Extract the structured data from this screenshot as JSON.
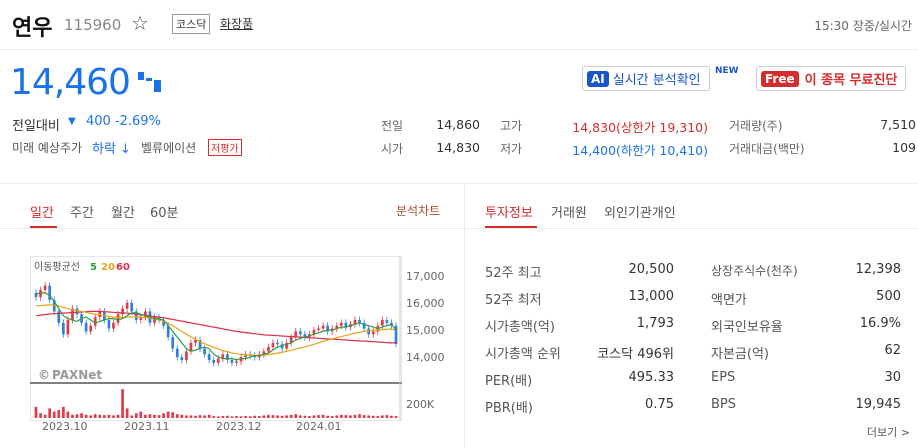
{
  "header": {
    "name": "연우",
    "code": "115960",
    "market": "코스닥",
    "sector": "화장품",
    "realtime": "15:30 장중/실시간"
  },
  "price": {
    "current": "14,460",
    "change_label": "전일대비",
    "change_value": "400 -2.69%",
    "future_label": "미래 예상주가",
    "future_value": "하락 ↓",
    "valuation_label": "벨류에이션",
    "valuation_badge": "저평가"
  },
  "promo": {
    "ai_tag": "AI",
    "ai_text": "실시간 분석확인",
    "new_tag": "NEW",
    "free_tag": "Free",
    "free_text": "이 종목 무료진단"
  },
  "stats": {
    "prev_label": "전일",
    "prev_value": "14,860",
    "open_label": "시가",
    "open_value": "14,830",
    "high_label": "고가",
    "high_value": "14,830(상한가 19,310)",
    "low_label": "저가",
    "low_value": "14,400(하한가 10,410)",
    "volume_label": "거래량(주)",
    "volume_value": "7,510",
    "amount_label": "거래대금(백만)",
    "amount_value": "109"
  },
  "chart_tabs": {
    "daily": "일간",
    "weekly": "주간",
    "monthly": "월간",
    "minute": "60분",
    "analysis": "분석차트"
  },
  "chart_data": {
    "type": "line",
    "legend_title": "이동평균선",
    "ma_labels": [
      "5",
      "20",
      "60"
    ],
    "y_ticks": [
      "17,000",
      "16,000",
      "15,000",
      "14,000"
    ],
    "ylim": [
      13200,
      17400
    ],
    "volume_tick": "200K",
    "x_ticks": [
      "2023.10",
      "2023.11",
      "2023.12",
      "2024.01"
    ],
    "watermark": "PAXNet",
    "colors": {
      "ma5": "#2e9e3e",
      "ma20": "#e8a317",
      "ma60": "#d9304e",
      "up": "#e23b4b",
      "down": "#2f7fe0"
    },
    "closes": [
      16100,
      16350,
      16500,
      16000,
      15600,
      15200,
      14800,
      15300,
      15700,
      15500,
      15200,
      14900,
      15100,
      15400,
      15600,
      15300,
      15000,
      15200,
      15500,
      15700,
      15900,
      15600,
      15300,
      15400,
      15600,
      15200,
      15400,
      15300,
      15100,
      14700,
      14300,
      14000,
      13900,
      14200,
      14500,
      14600,
      14300,
      14100,
      13900,
      13800,
      13950,
      14100,
      13900,
      13800,
      13850,
      14000,
      14100,
      14050,
      14000,
      14100,
      14200,
      14350,
      14500,
      14450,
      14300,
      14500,
      14700,
      14900,
      14800,
      14700,
      14800,
      14950,
      15000,
      15100,
      14900,
      15000,
      15100,
      15200,
      15050,
      15150,
      15300,
      15200,
      15000,
      14800,
      14900,
      15100,
      15300,
      15200,
      15100,
      14460
    ],
    "ma5": [
      16200,
      16250,
      16250,
      16150,
      15950,
      15700,
      15450,
      15350,
      15300,
      15250,
      15350,
      15400,
      15300,
      15200,
      15250,
      15300,
      15350,
      15350,
      15300,
      15350,
      15450,
      15550,
      15550,
      15500,
      15450,
      15400,
      15350,
      15350,
      15300,
      15100,
      14900,
      14700,
      14500,
      14300,
      14200,
      14250,
      14300,
      14350,
      14300,
      14100,
      14000,
      13950,
      13950,
      13950,
      13900,
      13950,
      13950,
      14000,
      14050,
      14050,
      14100,
      14150,
      14250,
      14350,
      14400,
      14450,
      14500,
      14600,
      14650,
      14700,
      14750,
      14800,
      14850,
      14900,
      14950,
      14950,
      15000,
      15050,
      15050,
      15100,
      15150,
      15200,
      15150,
      15100,
      15050,
      15000,
      15050,
      15100,
      15150,
      14950
    ],
    "ma20": [
      15800,
      15800,
      15820,
      15830,
      15820,
      15790,
      15740,
      15700,
      15660,
      15620,
      15600,
      15570,
      15530,
      15500,
      15480,
      15450,
      15420,
      15400,
      15390,
      15390,
      15400,
      15410,
      15410,
      15400,
      15390,
      15370,
      15340,
      15300,
      15250,
      15180,
      15100,
      15000,
      14900,
      14800,
      14710,
      14620,
      14540,
      14470,
      14400,
      14340,
      14280,
      14230,
      14190,
      14150,
      14120,
      14100,
      14080,
      14070,
      14060,
      14060,
      14070,
      14090,
      14110,
      14140,
      14170,
      14200,
      14240,
      14280,
      14320,
      14360,
      14400,
      14450,
      14500,
      14550,
      14600,
      14640,
      14680,
      14720,
      14760,
      14800,
      14840,
      14870,
      14900,
      14920,
      14940,
      14950,
      14960,
      14970,
      14980,
      14950
    ],
    "ma60": [
      15450,
      15470,
      15490,
      15510,
      15520,
      15530,
      15540,
      15550,
      15560,
      15570,
      15580,
      15590,
      15600,
      15600,
      15600,
      15590,
      15580,
      15570,
      15560,
      15550,
      15540,
      15520,
      15500,
      15480,
      15460,
      15440,
      15420,
      15400,
      15380,
      15350,
      15320,
      15290,
      15260,
      15230,
      15200,
      15170,
      15140,
      15110,
      15080,
      15050,
      15020,
      14990,
      14960,
      14930,
      14900,
      14880,
      14860,
      14840,
      14820,
      14800,
      14780,
      14770,
      14760,
      14750,
      14740,
      14730,
      14720,
      14710,
      14700,
      14690,
      14680,
      14670,
      14660,
      14650,
      14640,
      14630,
      14620,
      14610,
      14600,
      14590,
      14580,
      14570,
      14560,
      14550,
      14540,
      14530,
      14520,
      14510,
      14500,
      14500
    ],
    "volume_fractions": [
      0.35,
      0.15,
      0.1,
      0.3,
      0.2,
      0.25,
      0.35,
      0.2,
      0.1,
      0.12,
      0.15,
      0.1,
      0.08,
      0.12,
      0.1,
      0.09,
      0.1,
      0.08,
      0.1,
      0.9,
      0.3,
      0.08,
      0.15,
      0.2,
      0.1,
      0.12,
      0.1,
      0.09,
      0.15,
      0.2,
      0.18,
      0.12,
      0.1,
      0.08,
      0.08,
      0.07,
      0.09,
      0.08,
      0.1,
      0.06,
      0.05,
      0.06,
      0.07,
      0.05,
      0.06,
      0.05,
      0.06,
      0.05,
      0.07,
      0.06,
      0.08,
      0.1,
      0.09,
      0.08,
      0.07,
      0.08,
      0.1,
      0.12,
      0.08,
      0.07,
      0.06,
      0.08,
      0.09,
      0.1,
      0.07,
      0.06,
      0.08,
      0.1,
      0.09,
      0.08,
      0.1,
      0.12,
      0.09,
      0.08,
      0.07,
      0.06,
      0.08,
      0.09,
      0.07,
      0.06
    ]
  },
  "invest_tabs": {
    "invest": "투자정보",
    "broker": "거래원",
    "foreign": "외인기관개인"
  },
  "invest": {
    "left": [
      {
        "label": "52주 최고",
        "value": "20,500"
      },
      {
        "label": "52주 최저",
        "value": "13,000"
      },
      {
        "label": "시가총액(억)",
        "value": "1,793"
      },
      {
        "label": "시가총액 순위",
        "value": "코스닥 496위"
      },
      {
        "label": "PER(배)",
        "value": "495.33"
      },
      {
        "label": "PBR(배)",
        "value": "0.75"
      }
    ],
    "right": [
      {
        "label": "상장주식수(천주)",
        "value": "12,398"
      },
      {
        "label": "액면가",
        "value": "500"
      },
      {
        "label": "외국인보유율",
        "value": "16.9%"
      },
      {
        "label": "자본금(억)",
        "value": "62"
      },
      {
        "label": "EPS",
        "value": "30"
      },
      {
        "label": "BPS",
        "value": "19,945"
      }
    ],
    "more": "더보기 >"
  }
}
